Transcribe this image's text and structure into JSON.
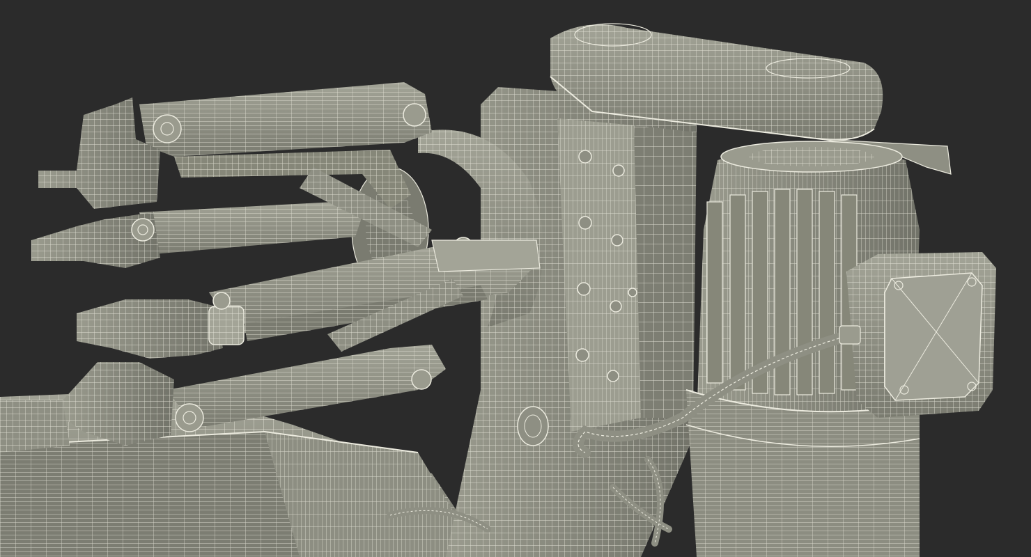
{
  "scene": {
    "subject": "wireframe-render",
    "colors": {
      "background": "#2b2b2b",
      "surface": "#8e8f83",
      "surface_light": "#a3a497",
      "surface_dark": "#6f7066",
      "wire": "#ecebdf"
    }
  }
}
